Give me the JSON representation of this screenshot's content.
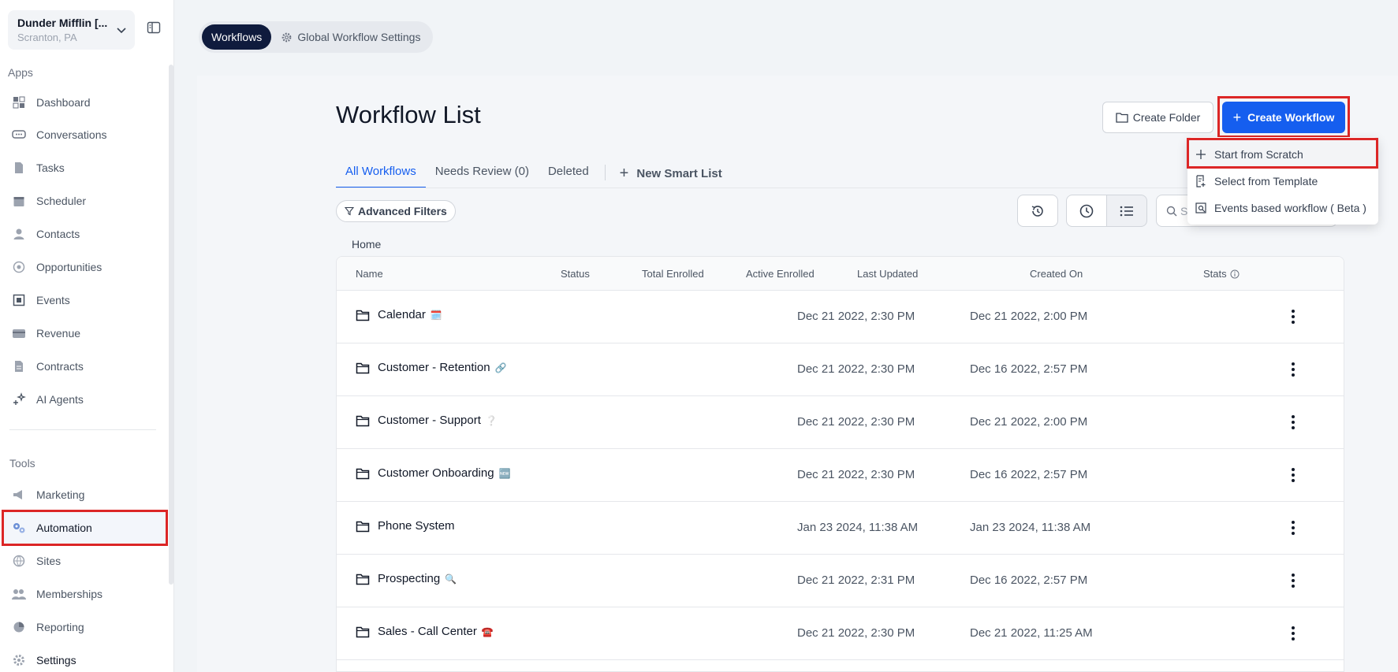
{
  "account": {
    "name": "Dunder Mifflin [...",
    "location": "Scranton, PA"
  },
  "sidebar": {
    "apps_label": "Apps",
    "tools_label": "Tools",
    "apps": [
      {
        "label": "Dashboard",
        "icon": "dashboard-icon"
      },
      {
        "label": "Conversations",
        "icon": "chat-icon"
      },
      {
        "label": "Tasks",
        "icon": "document-icon"
      },
      {
        "label": "Scheduler",
        "icon": "calendar-icon"
      },
      {
        "label": "Contacts",
        "icon": "person-icon"
      },
      {
        "label": "Opportunities",
        "icon": "target-icon"
      },
      {
        "label": "Events",
        "icon": "events-icon"
      },
      {
        "label": "Revenue",
        "icon": "card-icon"
      },
      {
        "label": "Contracts",
        "icon": "contract-icon"
      },
      {
        "label": "AI Agents",
        "icon": "sparkle-icon"
      }
    ],
    "tools": [
      {
        "label": "Marketing",
        "icon": "megaphone-icon"
      },
      {
        "label": "Automation",
        "icon": "gears-icon"
      },
      {
        "label": "Sites",
        "icon": "globe-icon"
      },
      {
        "label": "Memberships",
        "icon": "group-icon"
      },
      {
        "label": "Reporting",
        "icon": "pie-icon"
      },
      {
        "label": "Settings",
        "icon": "gear-icon"
      }
    ]
  },
  "top_tabs": {
    "workflows": "Workflows",
    "global": "Global Workflow Settings"
  },
  "page": {
    "title": "Workflow List",
    "create_folder": "Create Folder",
    "create_workflow": "Create Workflow",
    "tabs": [
      "All Workflows",
      "Needs Review (0)",
      "Deleted"
    ],
    "new_smart_list": "New Smart List",
    "advanced_filters": "Advanced Filters",
    "search_placeholder": "S",
    "breadcrumb": "Home"
  },
  "table": {
    "columns": [
      "Name",
      "Status",
      "Total Enrolled",
      "Active Enrolled",
      "Last Updated",
      "Created On",
      "Stats"
    ],
    "rows": [
      {
        "name": "Calendar",
        "emoji": "🗓️",
        "updated": "Dec 21 2022, 2:30 PM",
        "created": "Dec 21 2022, 2:00 PM"
      },
      {
        "name": "Customer - Retention",
        "emoji": "🔗",
        "updated": "Dec 21 2022, 2:30 PM",
        "created": "Dec 16 2022, 2:57 PM"
      },
      {
        "name": "Customer - Support",
        "emoji": "❔",
        "updated": "Dec 21 2022, 2:30 PM",
        "created": "Dec 21 2022, 2:00 PM"
      },
      {
        "name": "Customer Onboarding",
        "emoji": "🆕",
        "updated": "Dec 21 2022, 2:30 PM",
        "created": "Dec 16 2022, 2:57 PM"
      },
      {
        "name": "Phone System",
        "emoji": "",
        "updated": "Jan 23 2024, 11:38 AM",
        "created": "Jan 23 2024, 11:38 AM"
      },
      {
        "name": "Prospecting",
        "emoji": "🔍",
        "updated": "Dec 21 2022, 2:31 PM",
        "created": "Dec 16 2022, 2:57 PM"
      },
      {
        "name": "Sales - Call Center",
        "emoji": "☎️",
        "updated": "Dec 21 2022, 2:30 PM",
        "created": "Dec 21 2022, 11:25 AM"
      }
    ]
  },
  "dropdown": {
    "items": [
      "Start from Scratch",
      "Select from Template",
      "Events based workflow ( Beta )"
    ]
  },
  "colors": {
    "primary": "#155eef",
    "highlight": "#dc2626",
    "nav_dark": "#0f1b3d"
  }
}
